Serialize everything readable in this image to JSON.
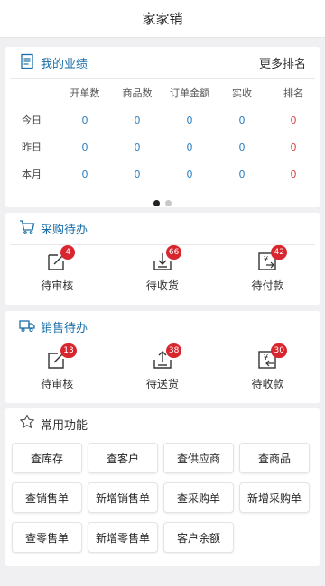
{
  "header": {
    "title": "家家销"
  },
  "performance": {
    "title": "我的业绩",
    "more": "更多排名",
    "columns": [
      "开单数",
      "商品数",
      "订单金额",
      "实收",
      "排名"
    ],
    "rows": [
      {
        "label": "今日",
        "values": [
          "0",
          "0",
          "0",
          "0",
          "0"
        ]
      },
      {
        "label": "昨日",
        "values": [
          "0",
          "0",
          "0",
          "0",
          "0"
        ]
      },
      {
        "label": "本月",
        "values": [
          "0",
          "0",
          "0",
          "0",
          "0"
        ]
      }
    ]
  },
  "purchase": {
    "title": "采购待办",
    "items": [
      {
        "label": "待审核",
        "count": "4",
        "icon": "edit-icon"
      },
      {
        "label": "待收货",
        "count": "66",
        "icon": "receive-icon"
      },
      {
        "label": "待付款",
        "count": "42",
        "icon": "pay-icon"
      }
    ]
  },
  "sales": {
    "title": "销售待办",
    "items": [
      {
        "label": "待审核",
        "count": "13",
        "icon": "edit-icon"
      },
      {
        "label": "待送货",
        "count": "38",
        "icon": "deliver-icon"
      },
      {
        "label": "待收款",
        "count": "30",
        "icon": "collect-icon"
      }
    ]
  },
  "functions": {
    "title": "常用功能",
    "items": [
      "查库存",
      "查客户",
      "查供应商",
      "查商品",
      "查销售单",
      "新增销售单",
      "查采购单",
      "新增采购单",
      "查零售单",
      "新增零售单",
      "客户余额"
    ]
  },
  "colors": {
    "accent": "#1a6fa8",
    "number": "#2b7fc0",
    "rank": "#e04040",
    "badge": "#d8262f"
  }
}
